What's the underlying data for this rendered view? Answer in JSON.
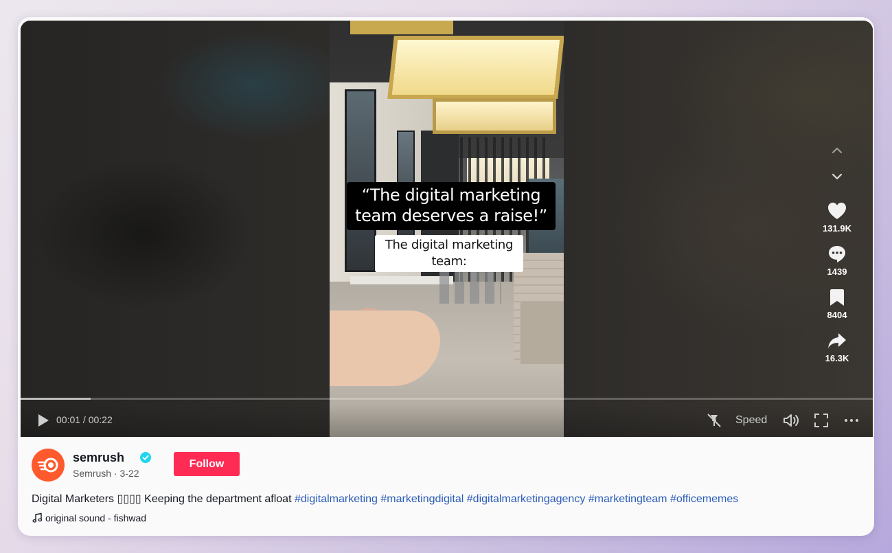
{
  "video": {
    "caption_primary": "“The digital marketing team deserves a raise!”",
    "caption_secondary": "The digital marketing team:",
    "progress_fraction": 0.082,
    "time": "00:01 / 00:22",
    "speed_label": "Speed"
  },
  "actions": {
    "likes": "131.9K",
    "comments": "1439",
    "saves": "8404",
    "shares": "16.3K"
  },
  "post": {
    "username": "semrush",
    "author_line": "Semrush · 3-22",
    "follow_label": "Follow",
    "description": "Digital Marketers ▯▯▯▯ Keeping the department afloat",
    "hashtags": [
      "#digitalmarketing",
      "#marketingdigital",
      "#digitalmarketingagency",
      "#marketingteam",
      "#officememes"
    ],
    "sound": "original sound - fishwad"
  },
  "colors": {
    "follow": "#fe2c55",
    "hashtag": "#2b5db9",
    "verified": "#20d5ec",
    "avatar": "#ff5a2d"
  },
  "icons": [
    "chevron-up-icon",
    "chevron-down-icon",
    "heart-icon",
    "comment-icon",
    "bookmark-icon",
    "share-icon",
    "play-icon",
    "floating-player-icon",
    "volume-icon",
    "fullscreen-icon",
    "more-icon",
    "verified-icon",
    "music-note-icon"
  ]
}
